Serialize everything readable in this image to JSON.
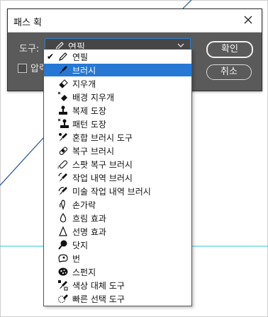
{
  "dialog": {
    "title": "패스 획",
    "tool_label": "도구:",
    "selected_tool": "연필",
    "simulate_pressure_label": "압력",
    "ok_label": "확인",
    "cancel_label": "취소"
  },
  "menu": {
    "items": [
      {
        "label": "연필",
        "checked": "✔",
        "icon": "pencil-icon"
      },
      {
        "label": "브러시",
        "icon": "brush-icon"
      },
      {
        "label": "지우개",
        "icon": "eraser-icon"
      },
      {
        "label": "배경 지우개",
        "icon": "background-eraser-icon"
      },
      {
        "label": "복제 도장",
        "icon": "clone-stamp-icon"
      },
      {
        "label": "패턴 도장",
        "icon": "pattern-stamp-icon"
      },
      {
        "label": "혼합 브러시 도구",
        "icon": "mixer-brush-icon"
      },
      {
        "label": "복구 브러시",
        "icon": "healing-brush-icon"
      },
      {
        "label": "스팟 복구 브러시",
        "icon": "spot-healing-brush-icon"
      },
      {
        "label": "작업 내역 브러시",
        "icon": "history-brush-icon"
      },
      {
        "label": "미술 작업 내역 브러시",
        "icon": "art-history-brush-icon"
      },
      {
        "label": "손가락",
        "icon": "smudge-icon"
      },
      {
        "label": "흐림 효과",
        "icon": "blur-icon"
      },
      {
        "label": "선명 효과",
        "icon": "sharpen-icon"
      },
      {
        "label": "닷지",
        "icon": "dodge-icon"
      },
      {
        "label": "번",
        "icon": "burn-icon"
      },
      {
        "label": "스펀지",
        "icon": "sponge-icon"
      },
      {
        "label": "색상 대체 도구",
        "icon": "color-replacement-icon"
      },
      {
        "label": "빠른 선택 도구",
        "icon": "quick-selection-icon"
      }
    ]
  },
  "colors": {
    "highlight": "#2678d4",
    "dialog_bg": "#5a5a5a",
    "guide": "#2ec4e6",
    "path": "#1f4f8a"
  }
}
